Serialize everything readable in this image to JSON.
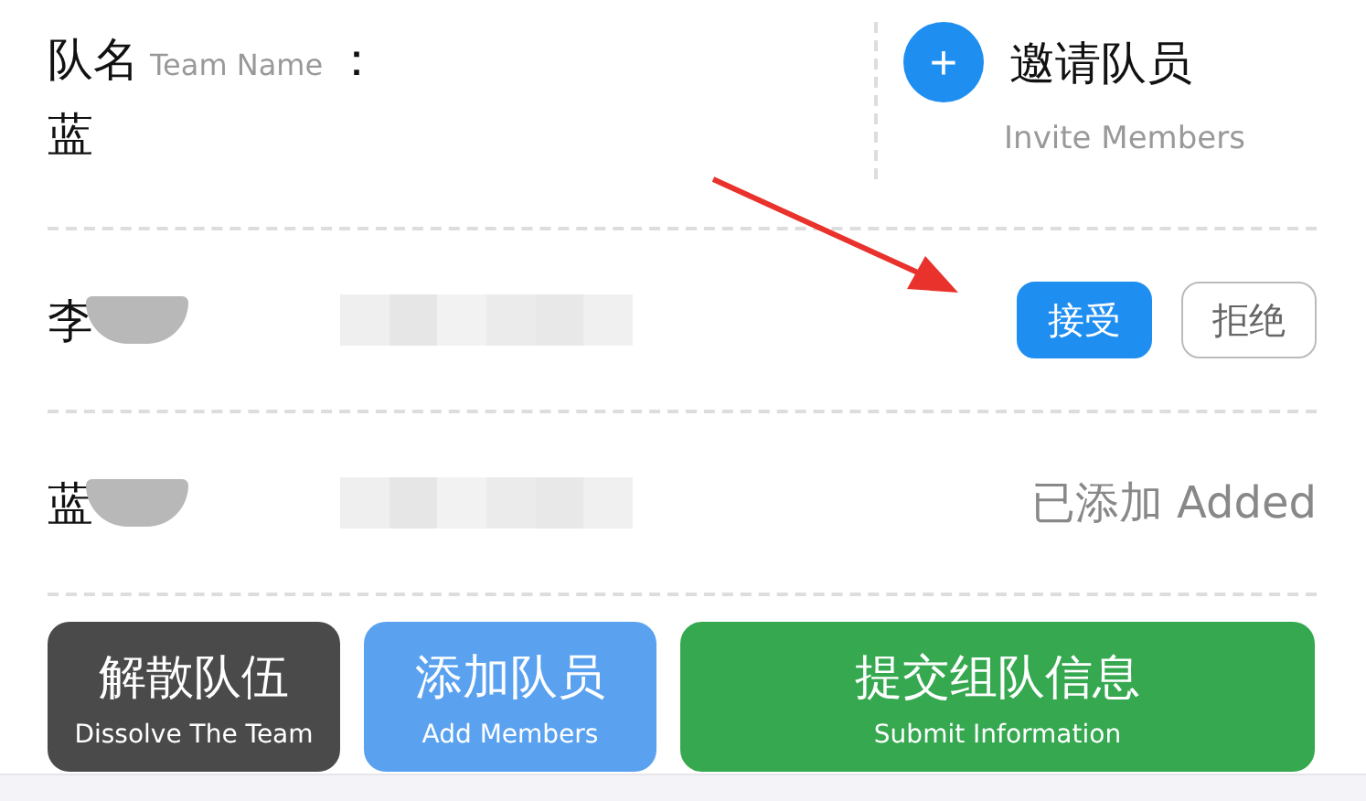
{
  "team": {
    "label": "队名",
    "label_en": "Team Name",
    "colon": "：",
    "name": "蓝"
  },
  "invite": {
    "icon": "+",
    "label": "邀请队员",
    "label_en": "Invite Members"
  },
  "members": [
    {
      "kind": "pending",
      "name": "李",
      "actions": [
        {
          "kind": "primary",
          "label": "接受"
        },
        {
          "kind": "outline",
          "label": "拒绝"
        }
      ]
    },
    {
      "kind": "added",
      "name": "蓝",
      "status": "已添加 Added"
    }
  ],
  "buttons": [
    {
      "label": "解散队伍",
      "label_en": "Dissolve The Team",
      "color": "#4a4a4a"
    },
    {
      "label": "添加队员",
      "label_en": "Add Members",
      "color": "#5aa2f0"
    },
    {
      "label": "提交组队信息",
      "label_en": "Submit Information",
      "color": "#35a850"
    }
  ]
}
